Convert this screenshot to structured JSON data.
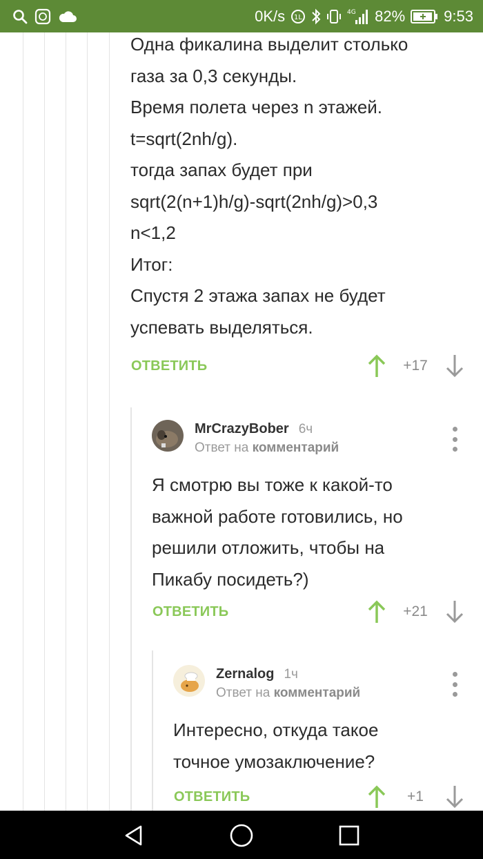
{
  "status_bar": {
    "speed": "0K/s",
    "network": "4G",
    "battery": "82%",
    "time": "9:53",
    "bar_color": "#5d8a36"
  },
  "comment_main": {
    "lines": [
      "Одна фикалина выделит столько",
      "газа за 0,3 секунды.",
      "Время полета через n этажей.",
      "t=sqrt(2nh/g).",
      "тогда запах будет при",
      "sqrt(2(n+1)h/g)-sqrt(2nh/g)>0,3",
      "n<1,2",
      "Итог:",
      "Спустя 2 этажа запах не будет",
      "успевать выделяться."
    ],
    "reply_label": "ОТВЕТИТЬ",
    "score": "+17"
  },
  "comment_2": {
    "author": "MrCrazyBober",
    "time": "6ч",
    "reply_prefix": "Ответ на",
    "reply_target": "комментарий",
    "lines": [
      "Я смотрю вы тоже к какой-то",
      "важной работе готовились, но",
      "решили отложить, чтобы на",
      "Пикабу посидеть?)"
    ],
    "reply_label": "ОТВЕТИТЬ",
    "score": "+21"
  },
  "comment_3": {
    "author": "Zernalog",
    "time": "1ч",
    "reply_prefix": "Ответ на",
    "reply_target": "комментарий",
    "lines": [
      "Интересно, откуда такое",
      "точное умозаключение?"
    ],
    "reply_label": "ОТВЕТИТЬ",
    "score": "+1"
  },
  "colors": {
    "accent_green": "#8ac858",
    "text": "#2b2b2b",
    "muted": "#9a9a9a"
  }
}
